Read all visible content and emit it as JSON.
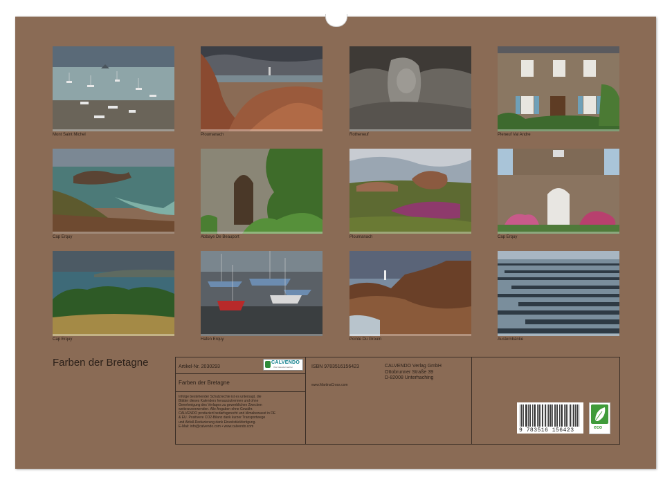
{
  "calendar": {
    "title": "Farben der Bretagne",
    "photos": [
      {
        "caption": "Mont Saint Michel"
      },
      {
        "caption": "Ploumanach"
      },
      {
        "caption": "Rotheneuf"
      },
      {
        "caption": "Pleneuf Val Andre"
      },
      {
        "caption": "Cap Erquy"
      },
      {
        "caption": "Abbaye De Beauport"
      },
      {
        "caption": "Ploumanach"
      },
      {
        "caption": "Cap Erquy"
      },
      {
        "caption": "Cap Erquy"
      },
      {
        "caption": "Hafen Erquy"
      },
      {
        "caption": "Pointe Du Grouin"
      },
      {
        "caption": "Austernbänke"
      }
    ]
  },
  "back_cover": {
    "article_number": "Artikel-Nr. 2030293",
    "product_title": "Farben der Bretagne",
    "legal_lines": [
      "Infolge bestehender Schutzrechte ist es untersagt, die",
      "Blätter dieses Kalenders herauszutrennen und ohne",
      "Genehmigung des Verlages zu gewerblichen Zwecken",
      "weiterzuverwenden. Alle Angaben ohne Gewähr.",
      "CALVENDO produziert bedarfsgerecht und klimabewusst in DE",
      "& EU. Positivere CO2-Bilanz dank kurzer Transportwege",
      "und Abfall-Reduzierung dank Einzelstückfertigung.",
      "E-Mail: info@calvendo.com • www.calvendo.com"
    ],
    "isbn": "ISBN 9783516156423",
    "publisher_lines": [
      "CALVENDO Verlag GmbH",
      "Ottobrunner Straße 39",
      "D-82008 Unterhaching"
    ],
    "website": "www.MartinaCross.com",
    "logo_text": "CALVENDO",
    "logo_subtext": "Ihre Kalendermacher",
    "barcode_number": "9 783516 156423",
    "eco_label": "eco"
  },
  "colors": {
    "page_brown": "#8a6b55",
    "frame_line": "#3a2e26"
  }
}
